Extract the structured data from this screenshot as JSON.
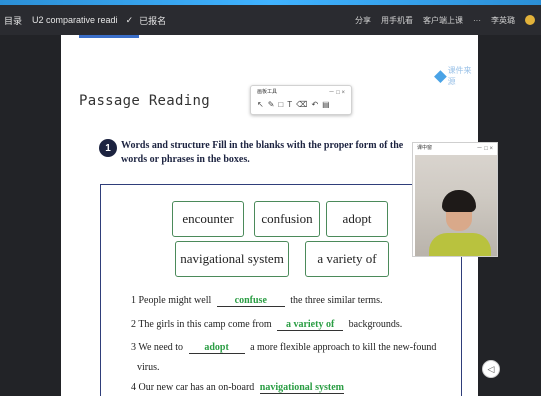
{
  "titlebar": {
    "menu_label": "目录",
    "doc_title": "U2 comparative readi",
    "check_icon": "check-icon",
    "status": "已报名",
    "actions": [
      "分享",
      "用手机看",
      "客户端上课",
      "···"
    ],
    "user_name": "李英璐"
  },
  "page": {
    "heading": "Passage Reading",
    "logo_text": "课件来源",
    "question_number": "1",
    "instruction": "Words and structure  Fill in the blanks with the proper form of the words or phrases in the boxes.",
    "word_box": [
      "encounter",
      "confusion",
      "adopt",
      "navigational system",
      "a variety of"
    ],
    "sentences": [
      {
        "num": "1",
        "before": "People might well",
        "answer": "confuse",
        "after": "the three similar terms."
      },
      {
        "num": "2",
        "before": "The girls in this camp come from",
        "answer": "a variety of",
        "after": "backgrounds."
      },
      {
        "num": "3",
        "before": "We need to",
        "answer": "adopt",
        "after": "a more flexible approach to kill the new-found",
        "continuation": "virus."
      },
      {
        "num": "4",
        "before": "Our new car has an on-board",
        "answer": "navigational system",
        "after": ""
      }
    ]
  },
  "toolbar": {
    "title": "画板工具",
    "controls": "－ □ ×",
    "tools": [
      "pointer-icon",
      "pen-icon",
      "rectangle-icon",
      "text-icon",
      "eraser-icon",
      "undo-icon",
      "trash-icon"
    ]
  },
  "video": {
    "title": "课中窗",
    "controls": "－ □ ×"
  },
  "colors": {
    "answer": "#2a9d43",
    "box_border": "#2f3e7a",
    "badge": "#1c2340"
  }
}
